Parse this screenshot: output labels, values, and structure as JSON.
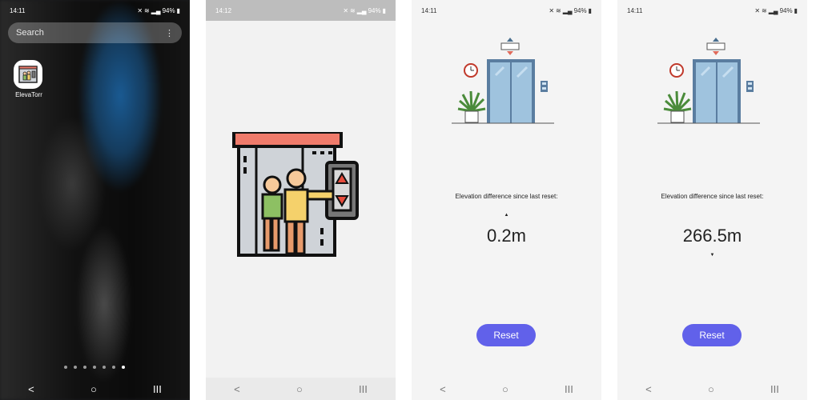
{
  "screen1": {
    "status": {
      "time": "14:11",
      "battery": "94%"
    },
    "search": {
      "placeholder": "Search"
    },
    "app": {
      "label": "ElevaTorr"
    },
    "pages": {
      "count": 7,
      "active_index": 6
    },
    "nav": {
      "back": "<",
      "home": "○",
      "recents": "III"
    }
  },
  "screen2": {
    "status": {
      "time": "14:12",
      "battery": "94%"
    },
    "nav": {
      "back": "<",
      "home": "○",
      "recents": "III"
    }
  },
  "screen3": {
    "status": {
      "time": "14:11",
      "battery": "94%"
    },
    "label": "Elevation difference since last reset:",
    "value": "0.2m",
    "direction": "up",
    "button": "Reset",
    "nav": {
      "back": "<",
      "home": "○",
      "recents": "III"
    }
  },
  "screen4": {
    "status": {
      "time": "14:11",
      "battery": "94%"
    },
    "label": "Elevation difference since last reset:",
    "value": "266.5m",
    "direction": "down",
    "button": "Reset",
    "nav": {
      "back": "<",
      "home": "○",
      "recents": "III"
    }
  },
  "colors": {
    "accent": "#6161ea",
    "elevator_frame": "#5a7da0",
    "elevator_glass": "#9fc3de",
    "splash_top": "#f07b6b"
  }
}
